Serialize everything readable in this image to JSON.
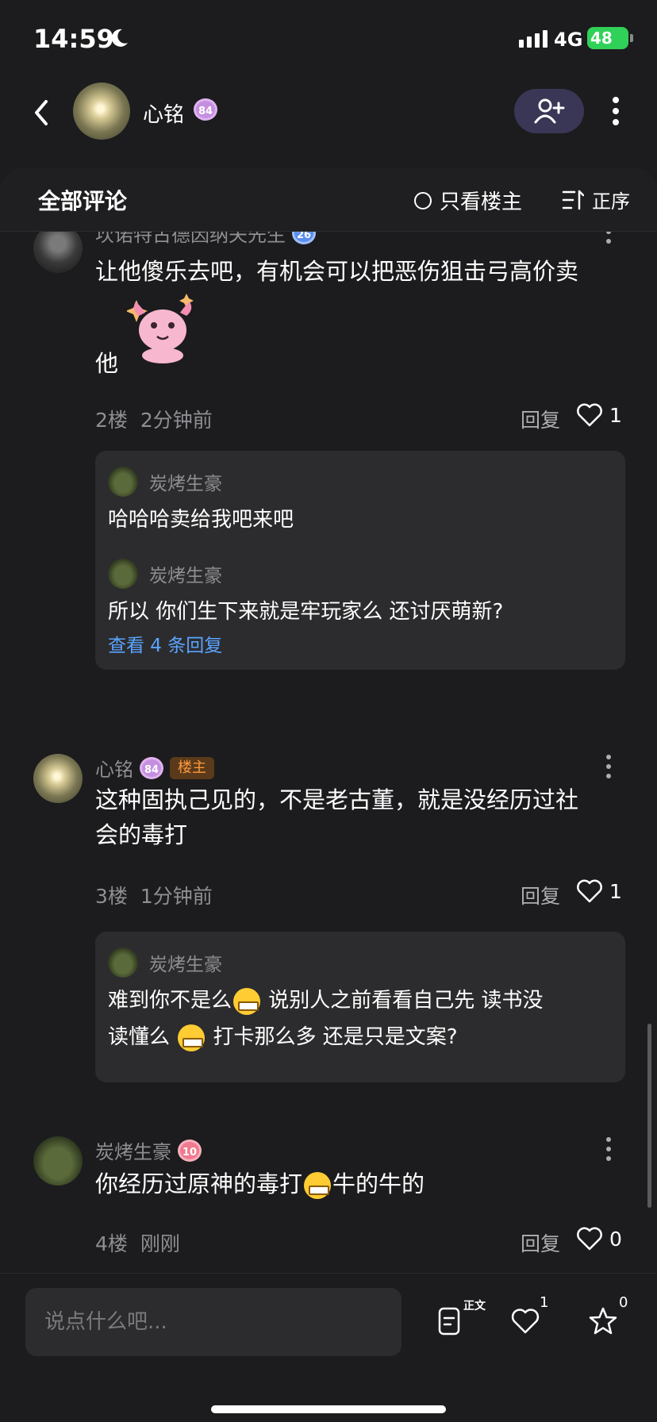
{
  "status": {
    "time": "14:59",
    "network": "4G",
    "battery": "48"
  },
  "header": {
    "name": "心铭",
    "level": "84"
  },
  "sheet": {
    "title": "全部评论",
    "only_op": "只看楼主",
    "sort_label": "正序"
  },
  "comments": [
    {
      "user": "坎诺特古德因纳夫先生",
      "level": "26",
      "text_line1": "让他傻乐去吧，有机会可以把恶伤狙击弓高价卖",
      "text_line2": "他",
      "floor": "2楼",
      "time": "2分钟前",
      "reply_label": "回复",
      "likes": "1",
      "replies": [
        {
          "user": "炭烤生豪",
          "text": "哈哈哈卖给我吧来吧"
        },
        {
          "user": "炭烤生豪",
          "text": "所以 你们生下来就是牢玩家么 还讨厌萌新?"
        }
      ],
      "view_more": "查看 4 条回复"
    },
    {
      "user": "心铭",
      "level": "84",
      "op_tag": "楼主",
      "text_line1": "这种固执己见的，不是老古董，就是没经历过社",
      "text_line2": "会的毒打",
      "floor": "3楼",
      "time": "1分钟前",
      "reply_label": "回复",
      "likes": "1",
      "replies": [
        {
          "user": "炭烤生豪",
          "text_a": "难到你不是么",
          "text_b": "说别人之前看看自己先  读书没",
          "text_c": "读懂么",
          "text_d": "打卡那么多 还是只是文案?"
        }
      ]
    },
    {
      "user": "炭烤生豪",
      "level": "10",
      "text_a": "你经历过原神的毒打",
      "text_b": "牛的牛的",
      "floor": "4楼",
      "time": "刚刚",
      "reply_label": "回复",
      "likes": "0"
    }
  ],
  "bottom": {
    "placeholder": "说点什么吧...",
    "doc_sup": "正文",
    "like_count": "1",
    "fav_count": "0"
  },
  "colors": {
    "background": "#1c1c1e",
    "card": "#2c2c2e",
    "link": "#5aa4ff",
    "op_tag": "#ff9a3c",
    "battery": "#30d158"
  }
}
